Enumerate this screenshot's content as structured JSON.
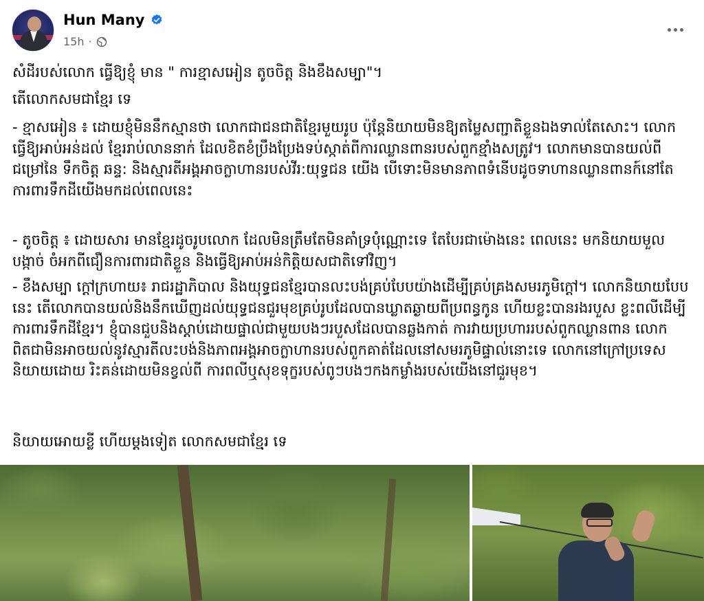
{
  "post": {
    "author": "Hun Many",
    "time": "15h",
    "verified_icon": "verified-badge-icon",
    "audience_icon": "globe-icon",
    "more_icon": "more-options-icon"
  },
  "text": {
    "p1": "សំដីរបស់លោក ធ្វើឱ្យខ្ញុំ មាន \" ការខ្មាសអៀន តូចចិត្ត និងខឹងសម្បា\"។",
    "p2": "តើលោកសមជាខ្មែរ ទេ",
    "p3": "- ខ្មាសអៀន ៖ ដោយខ្ញុំមិននឹកស្មានថា លោកជាជនជាតិខ្មែរមួយរូប ប៉ុន្តែនិយាយមិនឱ្យតម្លៃសញ្ជាតិខ្លួនឯងទាល់តែសោះ។ លោកធ្វើឱ្យអាប់អន់ដល់ ខ្មែររាប់លាននាក់ ដែលខិតខំប្រឹងប្រែងទប់ស្កាត់ពីការឈ្លានពានរបស់ពួកខ្មាំងសត្រូវ។ លោកមានបានយល់ពីជម្រៅនៃ ទឹកចិត្ត ឆន្ទ: និងស្មារតីអង្គអាចក្លាហានរបស់វីរ:យុទ្ធជន យើង បើទោះមិនមានភាពទំនើបដូចទាហានឈ្លានពានក៍នៅតែការពារទឹកដីយើងមកដល់ពេលនេះ",
    "p4": "- តូចចិត្ត ៖ ដោយសារ មានខ្មែរដូចរូបលោក ដែលមិនត្រឹមតែមិនគាំទ្របុំណ្ណោះទេ តែបែរជាម៉ោងនេះ ពេលនេះ មកនិយាយមួលបង្កាច់ ចំអកពីជឿនការពារជាតិខ្លួន និងធ្វើឱ្យអាប់អន់កិត្តិយសជាតិទៅវិញ។",
    "p5": "- ខឹងសម្បា ក្តៅក្រហាយ៖ រាជរដ្ឋាភិបាល និងយុទ្ធជនខ្មែរបានលះបង់គ្រប់បែបយ៉ាងដើម្បីគ្រប់គ្រងសមរភូមិក្តៅ។ លោកនិយាយបែបនេះ តើលោកបានយល់និងនឹកឃើញដល់យុទ្ធជនជួរមុខគ្រប់រូបដែលបានឃ្លាតឆ្ងាយពីប្រពន្ធកូន ហើយខ្លះបានរងរបួស ខ្លះពលីដើម្បីការពារទឹកដីខ្មែរ។ ខ្ញុំបានជួបនិងស្តាប់ដោយផ្ទាល់ជាមួយបងៗរបួសដែលបានឆ្លងកាត់ ការវាយប្រហាររបស់ពួកឈ្លានពាន លោកពិតជាមិនអាចយល់នូវស្មារតីលះបង់និងភាពអង្គអាចក្លាហានរបស់ពួកគាត់ដែលនៅសមរភូមិផ្ទាល់នោះទេ លោកនៅក្រៅប្រទេសនិយាយដោយ រិះគន់ដោយមិនខ្វល់ពី ការពលីឬសុខទុក្ខរបស់ពូៗបងៗកងកម្លាំងរបស់យើងនៅជួរមុខ។",
    "p6": "និយាយអោយខ្លី ហើយម្តងទៀត លោកសមជាខ្មែរ ទេ"
  }
}
